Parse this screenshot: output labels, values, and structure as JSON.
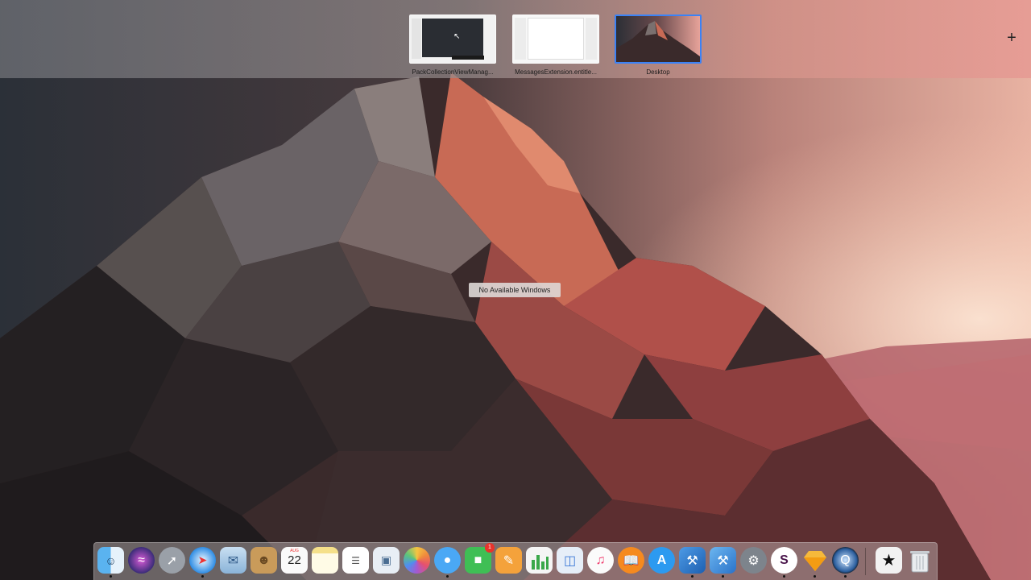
{
  "spaces": [
    {
      "label": "PackCollectionViewManag..."
    },
    {
      "label": "MessagesExtension.entitle..."
    },
    {
      "label": "Desktop"
    }
  ],
  "add_space": {
    "icon": "plus-icon",
    "glyph": "+"
  },
  "desktop_message": "No Available Windows",
  "dock": {
    "calendar": {
      "month": "AUG",
      "day": "22"
    },
    "facetime_badge": "1",
    "items": [
      "finder-icon",
      "siri-icon",
      "launchpad-icon",
      "safari-icon",
      "mail-icon",
      "contacts-icon",
      "calendar-icon",
      "notes-icon",
      "reminders-icon",
      "preview-icon",
      "photos-icon",
      "messages-icon",
      "facetime-icon",
      "pages-icon",
      "numbers-icon",
      "keynote-icon",
      "itunes-icon",
      "ibooks-icon",
      "app-store-icon",
      "xcode-icon",
      "instruments-icon",
      "system-preferences-icon",
      "slack-icon",
      "sketch-icon",
      "quicktime-icon",
      "reeder-icon",
      "trash-icon"
    ]
  }
}
